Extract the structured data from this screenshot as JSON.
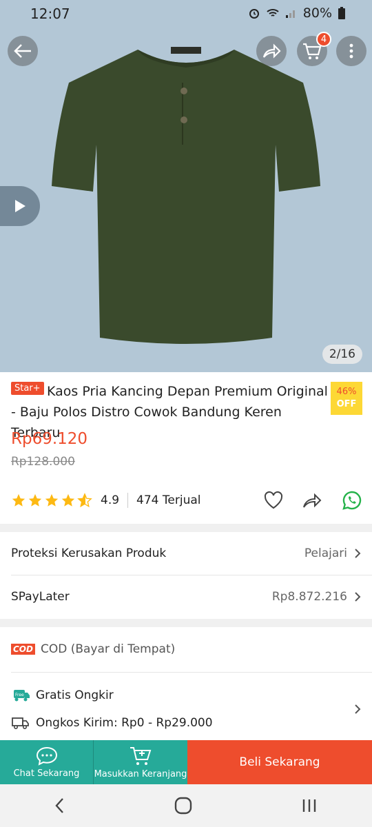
{
  "status_bar": {
    "time": "12:07",
    "battery": "80%"
  },
  "header": {
    "cart_count": "4",
    "image_counter": "2/16"
  },
  "product": {
    "badge": "Star+",
    "title": "Kaos Pria Kancing Depan Premium Original - Baju Polos Distro Cowok Bandung Keren Terbaru",
    "discount_pct": "46%",
    "discount_off": "OFF",
    "price": "Rp69.120",
    "original_price": "Rp128.000",
    "rating": "4.9",
    "rating_stars": 4.5,
    "sold": "474 Terjual"
  },
  "info_rows": {
    "protection_label": "Proteksi Kerusakan Produk",
    "protection_action": "Pelajari",
    "spaylater_label": "SPayLater",
    "spaylater_value": "Rp8.872.216",
    "cod_tag": "COD",
    "cod_label": "COD (Bayar di Tempat)",
    "free_shipping_tag": "Free",
    "free_shipping_label": "Gratis Ongkir",
    "shipping_cost_label": "Ongkos Kirim: Rp0 - Rp29.000"
  },
  "bottom_bar": {
    "chat_label": "Chat Sekarang",
    "cart_label": "Masukkan Keranjang",
    "buy_label": "Beli Sekarang"
  },
  "colors": {
    "accent": "#ee4d2d",
    "teal": "#26aa99",
    "hero_bg": "#b3c7d6",
    "shirt": "#3a4a2c",
    "star": "#fdb913"
  }
}
